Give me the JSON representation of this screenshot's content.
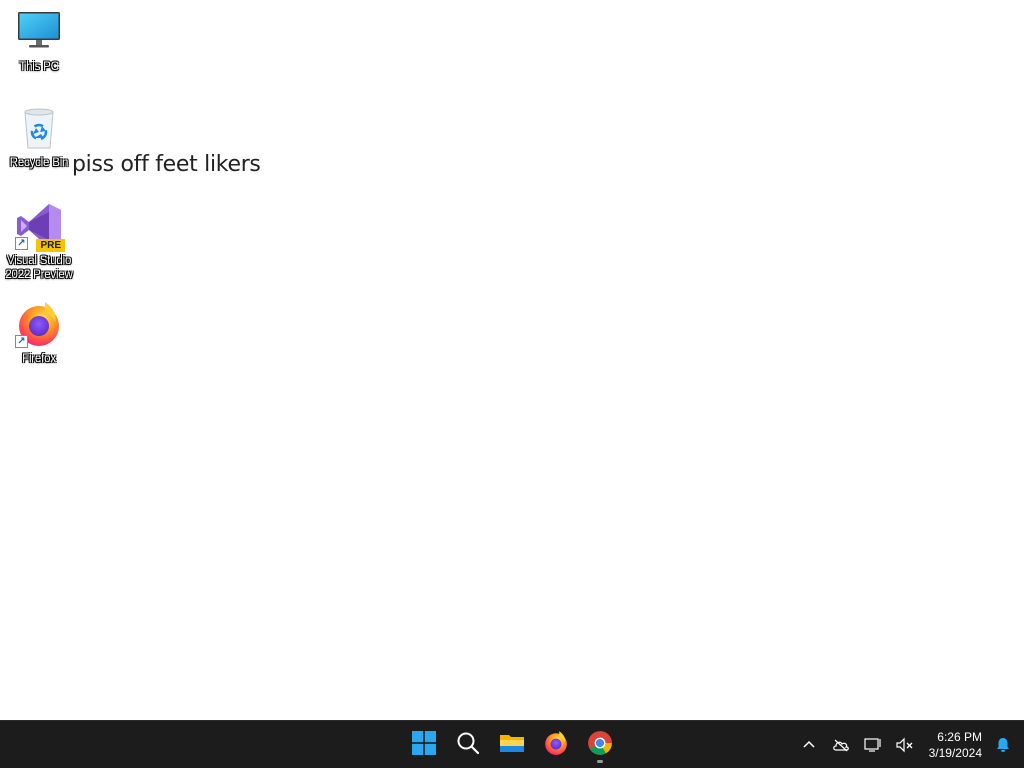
{
  "desktop": {
    "icons": [
      {
        "label": "This PC",
        "icon": "monitor-icon"
      },
      {
        "label": "Recycle Bin",
        "icon": "recycle-bin-icon"
      },
      {
        "label": "Visual Studio\n2022 Preview",
        "icon": "visual-studio-icon",
        "badge": "PRE"
      },
      {
        "label": "Firefox",
        "icon": "firefox-icon"
      }
    ],
    "overlay_text": "piss off feet likers"
  },
  "taskbar": {
    "pinned": [
      {
        "name": "start-button",
        "icon": "windows-logo-icon"
      },
      {
        "name": "search-button",
        "icon": "search-icon"
      },
      {
        "name": "file-explorer-button",
        "icon": "folder-icon"
      },
      {
        "name": "firefox-taskbar-button",
        "icon": "firefox-icon"
      },
      {
        "name": "chrome-taskbar-button",
        "icon": "chrome-icon",
        "running": true
      }
    ],
    "tray": {
      "icons": [
        "chevron-up-icon",
        "onedrive-offline-icon",
        "network-icon",
        "volume-muted-icon"
      ],
      "time": "6:26 PM",
      "date": "3/19/2024",
      "notification_icon": "bell-icon"
    }
  },
  "colors": {
    "taskbar_bg": "#1c1c1c",
    "desktop_bg": "#ffffff",
    "windows_blue": "#29a8f1"
  }
}
